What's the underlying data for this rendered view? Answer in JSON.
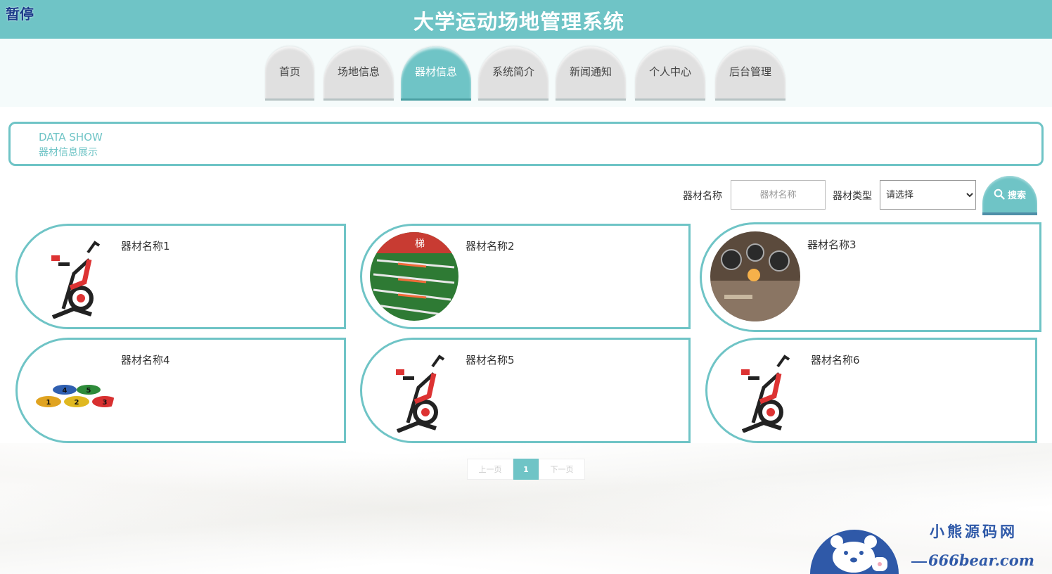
{
  "header": {
    "pause_label": "暂停",
    "site_title": "大学运动场地管理系统"
  },
  "nav": {
    "items": [
      {
        "label": "首页"
      },
      {
        "label": "场地信息"
      },
      {
        "label": "器材信息",
        "active": true
      },
      {
        "label": "系统简介"
      },
      {
        "label": "新闻通知"
      },
      {
        "label": "个人中心"
      },
      {
        "label": "后台管理"
      }
    ]
  },
  "section": {
    "title_en": "DATA SHOW",
    "title_cn": "器材信息展示"
  },
  "search": {
    "name_label": "器材名称",
    "name_placeholder": "器材名称",
    "type_label": "器材类型",
    "type_selected": "请选择",
    "button_label": "搜索"
  },
  "cards": [
    {
      "name": "器材名称1",
      "image": "exercise-bike"
    },
    {
      "name": "器材名称2",
      "image": "agility-ladder"
    },
    {
      "name": "器材名称3",
      "image": "gauge-panel"
    },
    {
      "name": "器材名称4",
      "image": "number-spot-markers"
    },
    {
      "name": "器材名称5",
      "image": "exercise-bike"
    },
    {
      "name": "器材名称6",
      "image": "exercise-bike"
    }
  ],
  "pager": {
    "prev_label": "上一页",
    "current_page": "1",
    "next_label": "下一页"
  },
  "watermark": {
    "brand_cn": "小熊源码网",
    "brand_url": "666bear.com"
  },
  "colors": {
    "accent": "#6fc4c6",
    "nav_inactive": "#e0e0e0",
    "brand_blue": "#2f59a8"
  }
}
